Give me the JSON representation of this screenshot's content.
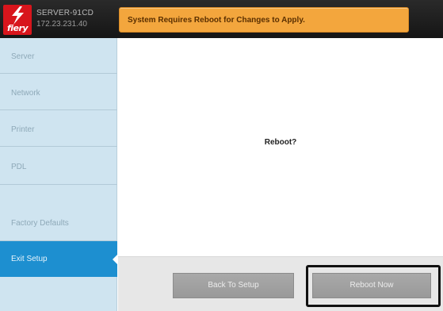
{
  "header": {
    "logo_text": "fiery",
    "server_name": "SERVER-91CD",
    "server_ip": "172.23.231.40",
    "alert_message": "System Requires Reboot for Changes to Apply."
  },
  "sidebar": {
    "items": [
      {
        "label": "Server"
      },
      {
        "label": "Network"
      },
      {
        "label": "Printer"
      },
      {
        "label": "PDL"
      },
      {
        "label": "Factory Defaults"
      },
      {
        "label": "Exit Setup"
      }
    ],
    "active": "Exit Setup"
  },
  "main": {
    "prompt": "Reboot?",
    "buttons": {
      "back_label": "Back To Setup",
      "reboot_label": "Reboot Now"
    }
  },
  "colors": {
    "brand_red": "#d8151c",
    "alert_orange": "#f3a63d",
    "active_blue": "#1d8fd0",
    "sidebar_bg": "#cfe4f0"
  },
  "icons": {
    "logo": "fiery-bolt-icon",
    "active_indicator": "active-notch-icon"
  }
}
